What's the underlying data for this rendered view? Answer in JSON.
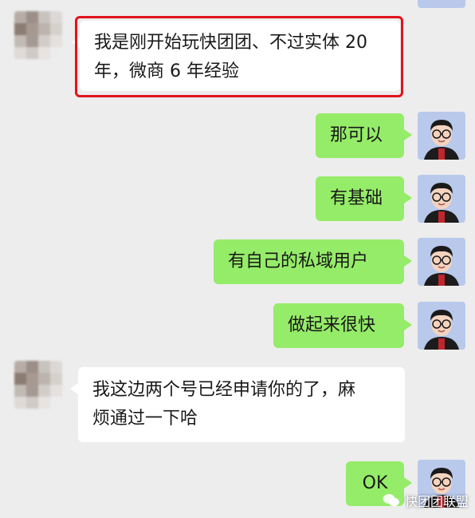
{
  "chat": {
    "messages": [
      {
        "side": "left",
        "text": "我是刚开始玩快团团、不过实体 20 年，微商 6 年经验",
        "line1": "我是刚开始玩快团团、不过实体 20",
        "line2": "年，微商 6 年经验"
      },
      {
        "side": "right",
        "text": "那可以"
      },
      {
        "side": "right",
        "text": "有基础"
      },
      {
        "side": "right",
        "text": "有自己的私域用户"
      },
      {
        "side": "right",
        "text": "做起来很快"
      },
      {
        "side": "left",
        "text": "我这边两个号已经申请你的了，麻烦通过一下哈",
        "line1": "我这边两个号已经申请你的了，麻",
        "line2": "烦通过一下哈"
      },
      {
        "side": "right",
        "text": "OK"
      }
    ]
  },
  "watermark": {
    "text": "快团团联盟",
    "icon": "wechat-icon"
  },
  "colors": {
    "background": "#ededed",
    "green_bubble": "#95ec69",
    "white_bubble": "#ffffff",
    "highlight": "#e0141e"
  }
}
